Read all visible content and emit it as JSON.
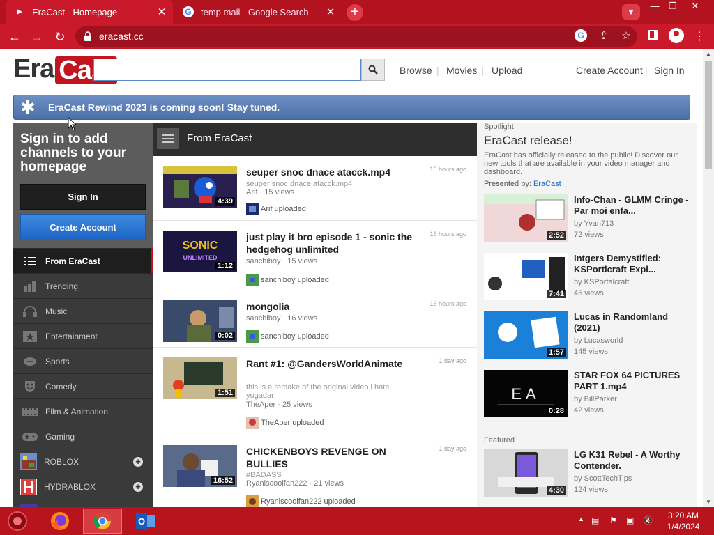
{
  "browser": {
    "tabs": [
      {
        "title": "EraCast - Homepage",
        "active": true
      },
      {
        "title": "temp mail - Google Search",
        "active": false
      }
    ],
    "url": "eracast.cc",
    "window_controls": {
      "minimize": "—",
      "restore": "❐",
      "close": "✕"
    }
  },
  "header": {
    "logo_left": "Era",
    "logo_right": "Cast",
    "search_placeholder": "",
    "nav": [
      "Browse",
      "Movies",
      "Upload"
    ],
    "account": [
      "Create Account",
      "Sign In"
    ]
  },
  "banner": {
    "text": "EraCast Rewind 2023 is coming soon! Stay tuned."
  },
  "sidebar": {
    "prompt": "Sign in to add channels to your homepage",
    "signin_label": "Sign In",
    "create_label": "Create Account",
    "items": [
      {
        "label": "From EraCast",
        "icon": "list-icon"
      },
      {
        "label": "Trending",
        "icon": "bar-chart-icon"
      },
      {
        "label": "Music",
        "icon": "headphones-icon"
      },
      {
        "label": "Entertainment",
        "icon": "star-box-icon"
      },
      {
        "label": "Sports",
        "icon": "football-icon"
      },
      {
        "label": "Comedy",
        "icon": "mask-icon"
      },
      {
        "label": "Film & Animation",
        "icon": "film-icon"
      },
      {
        "label": "Gaming",
        "icon": "gamepad-icon"
      },
      {
        "label": "ROBLOX",
        "icon": "roblox-icon"
      },
      {
        "label": "HYDRABLOX",
        "icon": "hydrablox-icon"
      }
    ]
  },
  "feed": {
    "title": "From EraCast",
    "items": [
      {
        "title": "seuper snoc dnace atacck.mp4",
        "desc": "seuper snoc dnace atacck.mp4",
        "meta": "Arif · 15 views",
        "time": "16 hours ago",
        "duration": "4:39",
        "uploader": "Arif uploaded"
      },
      {
        "title": "just play it bro episode 1 - sonic the hedgehog unlimited",
        "desc": "",
        "meta": "sanchiboy · 15 views",
        "time": "16 hours ago",
        "duration": "1:12",
        "uploader": "sanchiboy uploaded"
      },
      {
        "title": "mongolia",
        "desc": "",
        "meta": "sanchiboy · 16 views",
        "time": "16 hours ago",
        "duration": "0:02",
        "uploader": "sanchiboy uploaded"
      },
      {
        "title": "Rant #1: @GandersWorldAnimate",
        "desc": "this is a remake of the original video i hate yugadar",
        "meta": "TheAper · 25 views",
        "time": "1 day ago",
        "duration": "1:51",
        "uploader": "TheAper uploaded"
      },
      {
        "title": "CHICKENBOYS REVENGE ON BULLIES",
        "desc": "#BADASS",
        "meta": "Ryaniscoolfan222 · 21 views",
        "time": "1 day ago",
        "duration": "16:52",
        "uploader": "Ryaniscoolfan222 uploaded"
      }
    ]
  },
  "spotlight": {
    "label": "Spotlight",
    "title": "EraCast release!",
    "desc": "EraCast has officially released to the public! Discover our new tools that are available in your video manager and dashboard.",
    "presented_prefix": "Presented by:",
    "presented_by": "EraCast",
    "items": [
      {
        "title": "Info-Chan - GLMM Cringe - Par moi enfa...",
        "by": "by Yvan713",
        "views": "72 views",
        "duration": "2:52"
      },
      {
        "title": "Intgers Demystified: KSPortlcraft Expl...",
        "by": "by KSPortalcraft",
        "views": "45 views",
        "duration": "7:41"
      },
      {
        "title": "Lucas in Randomland (2021)",
        "by": "by Lucasworld",
        "views": "145 views",
        "duration": "1:57"
      },
      {
        "title": "STAR FOX 64 PICTURES PART 1.mp4",
        "by": "by BillParker",
        "views": "42 views",
        "duration": "0:28"
      }
    ]
  },
  "featured": {
    "label": "Featured",
    "items": [
      {
        "title": "LG K31 Rebel - A Worthy Contender.",
        "by": "by ScottTechTips",
        "views": "124 views",
        "duration": "4:30"
      }
    ]
  },
  "taskbar": {
    "time": "3:20 AM",
    "date": "1/4/2024"
  },
  "colors": {
    "brand_red": "#c2151f",
    "chrome_red": "#c9192a",
    "banner_blue": "#5a7db6",
    "link_blue": "#1e64c4"
  }
}
